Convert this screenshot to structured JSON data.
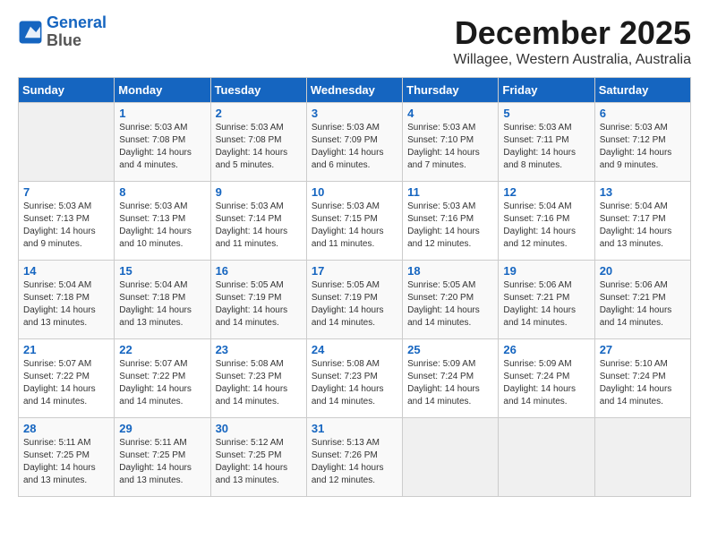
{
  "header": {
    "logo_line1": "General",
    "logo_line2": "Blue",
    "month": "December 2025",
    "location": "Willagee, Western Australia, Australia"
  },
  "days_of_week": [
    "Sunday",
    "Monday",
    "Tuesday",
    "Wednesday",
    "Thursday",
    "Friday",
    "Saturday"
  ],
  "weeks": [
    [
      {
        "day": "",
        "info": ""
      },
      {
        "day": "1",
        "info": "Sunrise: 5:03 AM\nSunset: 7:08 PM\nDaylight: 14 hours\nand 4 minutes."
      },
      {
        "day": "2",
        "info": "Sunrise: 5:03 AM\nSunset: 7:08 PM\nDaylight: 14 hours\nand 5 minutes."
      },
      {
        "day": "3",
        "info": "Sunrise: 5:03 AM\nSunset: 7:09 PM\nDaylight: 14 hours\nand 6 minutes."
      },
      {
        "day": "4",
        "info": "Sunrise: 5:03 AM\nSunset: 7:10 PM\nDaylight: 14 hours\nand 7 minutes."
      },
      {
        "day": "5",
        "info": "Sunrise: 5:03 AM\nSunset: 7:11 PM\nDaylight: 14 hours\nand 8 minutes."
      },
      {
        "day": "6",
        "info": "Sunrise: 5:03 AM\nSunset: 7:12 PM\nDaylight: 14 hours\nand 9 minutes."
      }
    ],
    [
      {
        "day": "7",
        "info": "Sunrise: 5:03 AM\nSunset: 7:13 PM\nDaylight: 14 hours\nand 9 minutes."
      },
      {
        "day": "8",
        "info": "Sunrise: 5:03 AM\nSunset: 7:13 PM\nDaylight: 14 hours\nand 10 minutes."
      },
      {
        "day": "9",
        "info": "Sunrise: 5:03 AM\nSunset: 7:14 PM\nDaylight: 14 hours\nand 11 minutes."
      },
      {
        "day": "10",
        "info": "Sunrise: 5:03 AM\nSunset: 7:15 PM\nDaylight: 14 hours\nand 11 minutes."
      },
      {
        "day": "11",
        "info": "Sunrise: 5:03 AM\nSunset: 7:16 PM\nDaylight: 14 hours\nand 12 minutes."
      },
      {
        "day": "12",
        "info": "Sunrise: 5:04 AM\nSunset: 7:16 PM\nDaylight: 14 hours\nand 12 minutes."
      },
      {
        "day": "13",
        "info": "Sunrise: 5:04 AM\nSunset: 7:17 PM\nDaylight: 14 hours\nand 13 minutes."
      }
    ],
    [
      {
        "day": "14",
        "info": "Sunrise: 5:04 AM\nSunset: 7:18 PM\nDaylight: 14 hours\nand 13 minutes."
      },
      {
        "day": "15",
        "info": "Sunrise: 5:04 AM\nSunset: 7:18 PM\nDaylight: 14 hours\nand 13 minutes."
      },
      {
        "day": "16",
        "info": "Sunrise: 5:05 AM\nSunset: 7:19 PM\nDaylight: 14 hours\nand 14 minutes."
      },
      {
        "day": "17",
        "info": "Sunrise: 5:05 AM\nSunset: 7:19 PM\nDaylight: 14 hours\nand 14 minutes."
      },
      {
        "day": "18",
        "info": "Sunrise: 5:05 AM\nSunset: 7:20 PM\nDaylight: 14 hours\nand 14 minutes."
      },
      {
        "day": "19",
        "info": "Sunrise: 5:06 AM\nSunset: 7:21 PM\nDaylight: 14 hours\nand 14 minutes."
      },
      {
        "day": "20",
        "info": "Sunrise: 5:06 AM\nSunset: 7:21 PM\nDaylight: 14 hours\nand 14 minutes."
      }
    ],
    [
      {
        "day": "21",
        "info": "Sunrise: 5:07 AM\nSunset: 7:22 PM\nDaylight: 14 hours\nand 14 minutes."
      },
      {
        "day": "22",
        "info": "Sunrise: 5:07 AM\nSunset: 7:22 PM\nDaylight: 14 hours\nand 14 minutes."
      },
      {
        "day": "23",
        "info": "Sunrise: 5:08 AM\nSunset: 7:23 PM\nDaylight: 14 hours\nand 14 minutes."
      },
      {
        "day": "24",
        "info": "Sunrise: 5:08 AM\nSunset: 7:23 PM\nDaylight: 14 hours\nand 14 minutes."
      },
      {
        "day": "25",
        "info": "Sunrise: 5:09 AM\nSunset: 7:24 PM\nDaylight: 14 hours\nand 14 minutes."
      },
      {
        "day": "26",
        "info": "Sunrise: 5:09 AM\nSunset: 7:24 PM\nDaylight: 14 hours\nand 14 minutes."
      },
      {
        "day": "27",
        "info": "Sunrise: 5:10 AM\nSunset: 7:24 PM\nDaylight: 14 hours\nand 14 minutes."
      }
    ],
    [
      {
        "day": "28",
        "info": "Sunrise: 5:11 AM\nSunset: 7:25 PM\nDaylight: 14 hours\nand 13 minutes."
      },
      {
        "day": "29",
        "info": "Sunrise: 5:11 AM\nSunset: 7:25 PM\nDaylight: 14 hours\nand 13 minutes."
      },
      {
        "day": "30",
        "info": "Sunrise: 5:12 AM\nSunset: 7:25 PM\nDaylight: 14 hours\nand 13 minutes."
      },
      {
        "day": "31",
        "info": "Sunrise: 5:13 AM\nSunset: 7:26 PM\nDaylight: 14 hours\nand 12 minutes."
      },
      {
        "day": "",
        "info": ""
      },
      {
        "day": "",
        "info": ""
      },
      {
        "day": "",
        "info": ""
      }
    ]
  ]
}
